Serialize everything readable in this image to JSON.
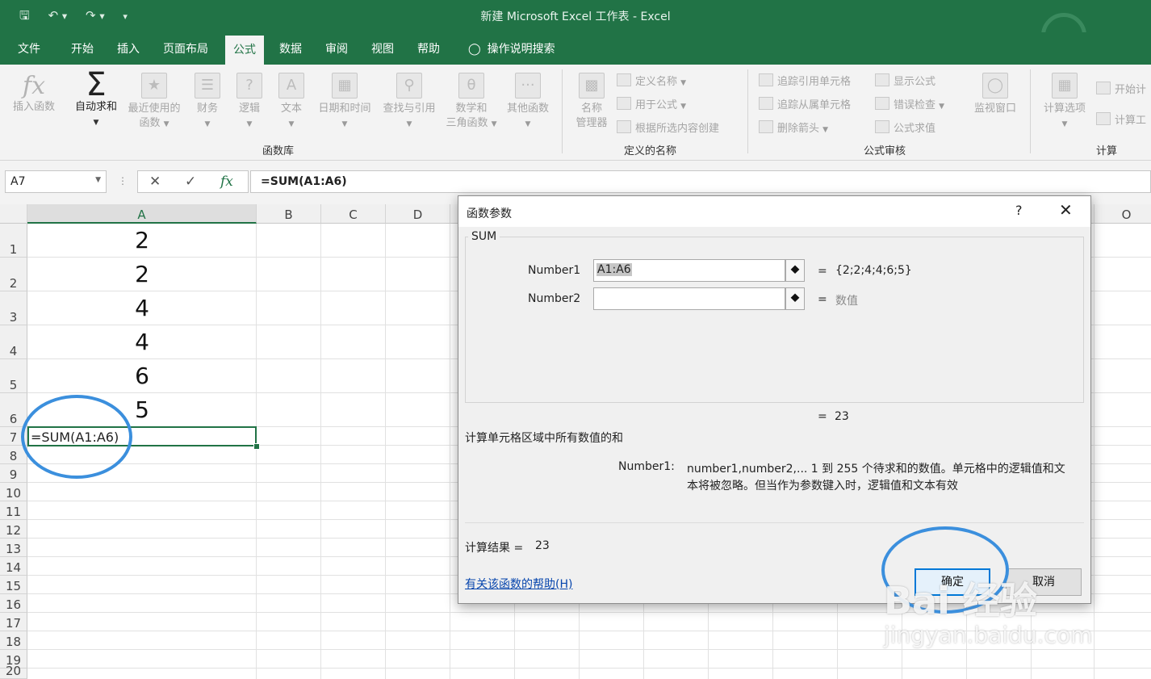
{
  "window": {
    "title": "新建 Microsoft Excel 工作表  -  Excel"
  },
  "qat": {
    "save_icon": "save-icon",
    "undo_icon": "undo-icon",
    "redo_icon": "redo-icon",
    "customize_icon": "customize-icon"
  },
  "tabs": [
    "文件",
    "开始",
    "插入",
    "页面布局",
    "公式",
    "数据",
    "审阅",
    "视图",
    "帮助"
  ],
  "active_tab": "公式",
  "tell_me": "操作说明搜索",
  "ribbon": {
    "function_library": {
      "label": "函数库",
      "insert_function": "插入函数",
      "autosum": "自动求和",
      "recent_line1": "最近使用的",
      "recent_line2": "函数",
      "financial": "财务",
      "logical": "逻辑",
      "text": "文本",
      "datetime": "日期和时间",
      "lookup": "查找与引用",
      "math_line1": "数学和",
      "math_line2": "三角函数",
      "more": "其他函数"
    },
    "defined_names": {
      "label": "定义的名称",
      "name_manager_line1": "名称",
      "name_manager_line2": "管理器",
      "define_name": "定义名称",
      "use_in_formula": "用于公式",
      "create_from_selection": "根据所选内容创建"
    },
    "formula_auditing": {
      "label": "公式审核",
      "trace_precedents": "追踪引用单元格",
      "trace_dependents": "追踪从属单元格",
      "remove_arrows": "删除箭头",
      "show_formulas": "显示公式",
      "error_checking": "错误检查",
      "evaluate_formula": "公式求值",
      "watch_window": "监视窗口"
    },
    "calculation": {
      "label": "计算",
      "options": "计算选项",
      "calc_now": "开始计",
      "calc_sheet": "计算工"
    }
  },
  "formula_bar": {
    "name_box": "A7",
    "formula": "=SUM(A1:A6)"
  },
  "grid": {
    "columns": [
      "A",
      "B",
      "C",
      "D",
      "O"
    ],
    "rows": [
      "1",
      "2",
      "3",
      "4",
      "5",
      "6",
      "7",
      "8",
      "9",
      "10",
      "11",
      "12",
      "13",
      "14",
      "15",
      "16",
      "17",
      "18",
      "19",
      "20"
    ],
    "values": [
      "2",
      "2",
      "4",
      "4",
      "6",
      "5"
    ],
    "active_cell_text": "=SUM(A1:A6)"
  },
  "dialog": {
    "title": "函数参数",
    "help": "?",
    "close": "✕",
    "function_name": "SUM",
    "args": [
      {
        "name": "Number1",
        "value": "A1:A6",
        "eval": "{2;2;4;4;6;5}"
      },
      {
        "name": "Number2",
        "value": "",
        "eval": "数值"
      }
    ],
    "eq": "=",
    "result_preview": "23",
    "description": "计算单元格区域中所有数值的和",
    "arg_help_label": "Number1:",
    "arg_help_line1": "number1,number2,... 1 到 255 个待求和的数值。单元格中的逻辑值和文",
    "arg_help_line2": "本将被忽略。但当作为参数键入时，逻辑值和文本有效",
    "calc_result_label": "计算结果 =",
    "calc_result_value": "23",
    "help_link": "有关该函数的帮助(H)",
    "ok": "确定",
    "cancel": "取消"
  },
  "watermark": {
    "line1": "Bai 经验",
    "line2": "jingyan.baidu.com"
  },
  "colors": {
    "excel_green": "#217346",
    "annotation_blue": "#3b8fdd"
  }
}
